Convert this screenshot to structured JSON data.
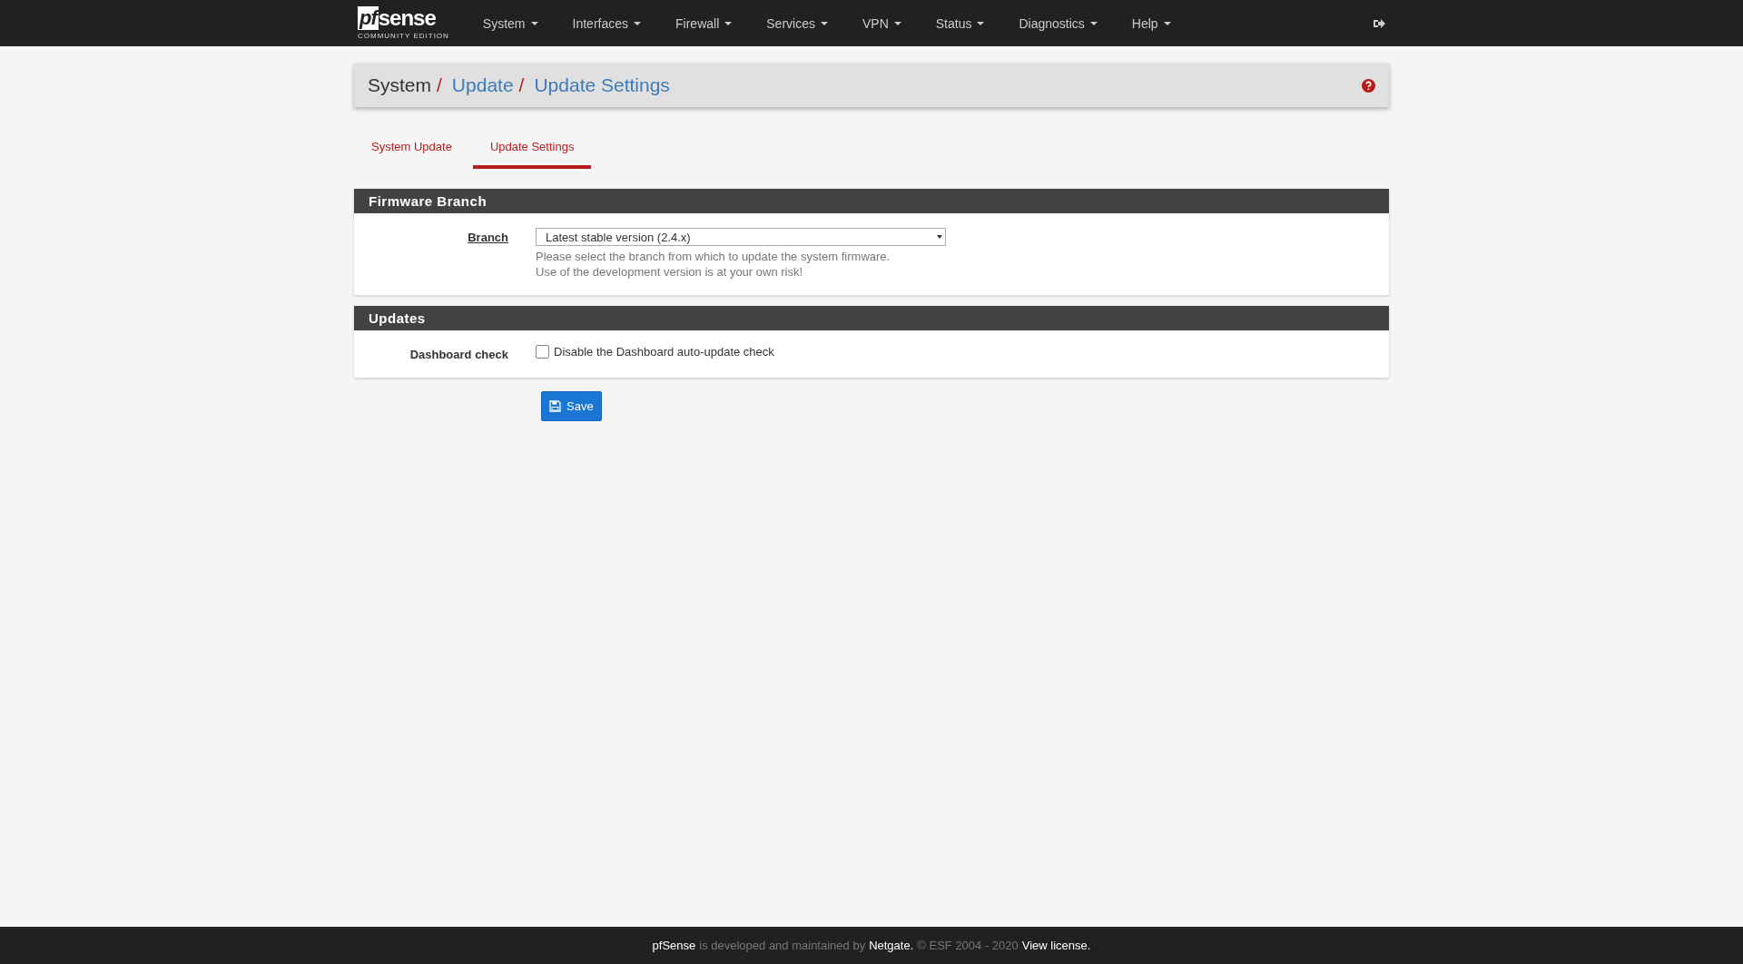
{
  "navbar": {
    "logo": {
      "mark": "pf",
      "word": "sense",
      "edition": "COMMUNITY EDITION"
    },
    "menus": [
      {
        "label": "System"
      },
      {
        "label": "Interfaces"
      },
      {
        "label": "Firewall"
      },
      {
        "label": "Services"
      },
      {
        "label": "VPN"
      },
      {
        "label": "Status"
      },
      {
        "label": "Diagnostics"
      },
      {
        "label": "Help"
      }
    ]
  },
  "breadcrumb_separator": "/",
  "breadcrumb": [
    {
      "label": "System",
      "kind": "plain"
    },
    {
      "label": "Update",
      "kind": "link"
    },
    {
      "label": "Update Settings",
      "kind": "link"
    }
  ],
  "tabs": [
    {
      "label": "System Update",
      "selected": false
    },
    {
      "label": "Update Settings",
      "selected": true
    }
  ],
  "panels": [
    {
      "title": "Firmware Branch",
      "rows": [
        {
          "kind": "select",
          "label": "Branch",
          "value": "Latest stable version (2.4.x)",
          "help": [
            "Please select the branch from which to update the system firmware.",
            "Use of the development version is at your own risk!"
          ]
        }
      ]
    },
    {
      "title": "Updates",
      "rows": [
        {
          "kind": "checkbox",
          "label": "Dashboard check",
          "text": "Disable the Dashboard auto-update check",
          "checked": false
        }
      ]
    }
  ],
  "save_button": "Save",
  "footer": [
    {
      "text": "pfSense",
      "kind": "link"
    },
    {
      "text": "is developed and maintained by",
      "kind": "plain"
    },
    {
      "text": "Netgate.",
      "kind": "link"
    },
    {
      "text": "© ESF 2004 - 2020",
      "kind": "plain"
    },
    {
      "text": "View license.",
      "kind": "link"
    }
  ]
}
